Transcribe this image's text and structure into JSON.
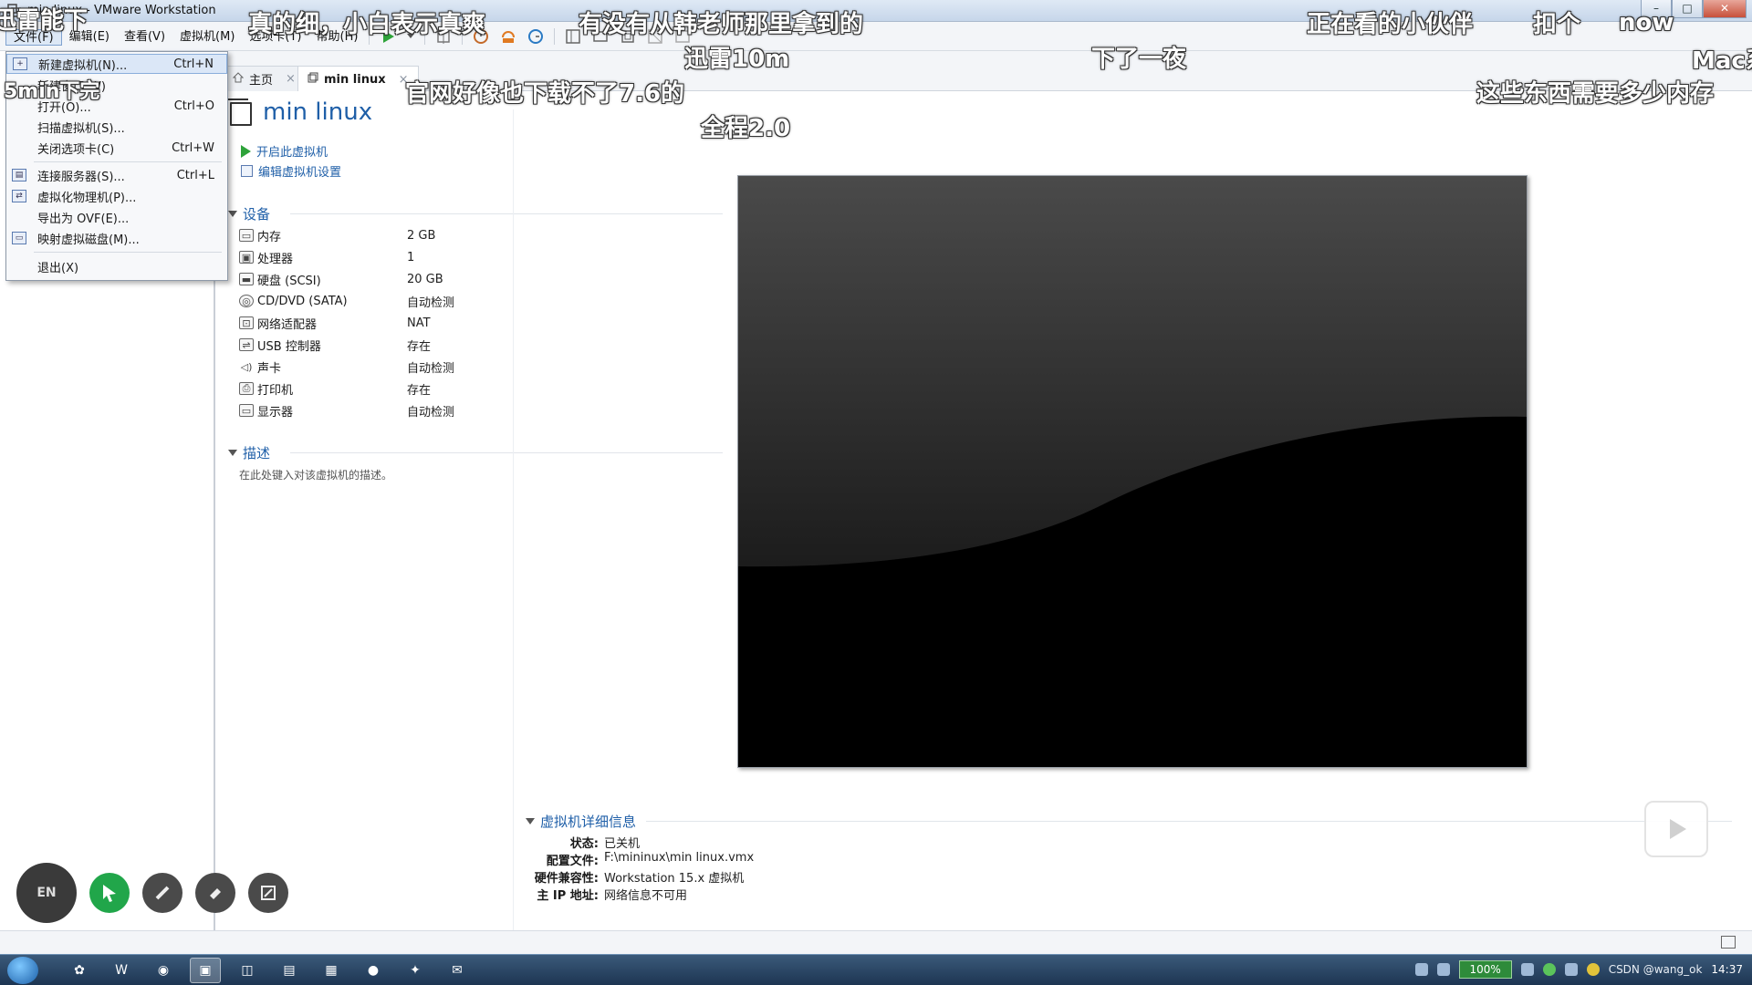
{
  "window": {
    "title": "min linux - VMware Workstation",
    "controls": {
      "minimize": "–",
      "maximize": "□",
      "close": "✕"
    }
  },
  "menu": [
    "文件(F)",
    "编辑(E)",
    "查看(V)",
    "虚拟机(M)",
    "选项卡(T)",
    "帮助(H)"
  ],
  "toolbar_icons": [
    "power-on-icon",
    "dropdown-arrow-icon",
    "send-keys-icon",
    "snapshot-icon",
    "revert-snapshot-icon",
    "snapshot-manager-icon",
    "library-view-icon",
    "thumbnail-icon",
    "full-screen-icon",
    "unity-icon",
    "console-view-icon"
  ],
  "file_menu": [
    {
      "label": "新建虚拟机(N)...",
      "shortcut": "Ctrl+N",
      "icon": "new-vm-icon"
    },
    {
      "label": "新建窗口(W)",
      "shortcut": "",
      "icon": ""
    },
    {
      "label": "打开(O)...",
      "shortcut": "Ctrl+O",
      "icon": ""
    },
    {
      "label": "扫描虚拟机(S)...",
      "shortcut": "",
      "icon": ""
    },
    {
      "label": "关闭选项卡(C)",
      "shortcut": "Ctrl+W",
      "icon": ""
    },
    {
      "label": "连接服务器(S)...",
      "shortcut": "Ctrl+L",
      "icon": "server-icon"
    },
    {
      "label": "虚拟化物理机(P)...",
      "shortcut": "",
      "icon": "virtualize-icon"
    },
    {
      "label": "导出为 OVF(E)...",
      "shortcut": "",
      "icon": ""
    },
    {
      "label": "映射虚拟磁盘(M)...",
      "shortcut": "",
      "icon": "disk-map-icon"
    },
    {
      "label": "退出(X)",
      "shortcut": "",
      "icon": ""
    }
  ],
  "tabs": [
    {
      "label": "主页",
      "close": "×"
    },
    {
      "label": "min linux",
      "close": "×"
    }
  ],
  "vm": {
    "name": "min linux",
    "actions": {
      "power_on": "开启此虚拟机",
      "edit_settings": "编辑虚拟机设置"
    },
    "devices_title": "设备",
    "devices": [
      {
        "name": "内存",
        "value": "2 GB",
        "icon": "memory-icon"
      },
      {
        "name": "处理器",
        "value": "1",
        "icon": "cpu-icon"
      },
      {
        "name": "硬盘 (SCSI)",
        "value": "20 GB",
        "icon": "hard-disk-icon"
      },
      {
        "name": "CD/DVD (SATA)",
        "value": "自动检测",
        "icon": "cd-dvd-icon"
      },
      {
        "name": "网络适配器",
        "value": "NAT",
        "icon": "network-adapter-icon"
      },
      {
        "name": "USB 控制器",
        "value": "存在",
        "icon": "usb-icon"
      },
      {
        "name": "声卡",
        "value": "自动检测",
        "icon": "sound-card-icon"
      },
      {
        "name": "打印机",
        "value": "存在",
        "icon": "printer-icon"
      },
      {
        "name": "显示器",
        "value": "自动检测",
        "icon": "display-icon"
      }
    ],
    "description_title": "描述",
    "description_placeholder": "在此处键入对该虚拟机的描述。",
    "details_title": "虚拟机详细信息",
    "details": [
      {
        "key": "状态:",
        "value": "已关机"
      },
      {
        "key": "配置文件:",
        "value": "F:\\mininux\\min linux.vmx"
      },
      {
        "key": "硬件兼容性:",
        "value": "Workstation 15.x 虚拟机"
      },
      {
        "key": "主 IP 地址:",
        "value": "网络信息不可用"
      }
    ]
  },
  "danmaku": [
    "迅雷能下",
    "5min下完",
    "真的细，小白表示真爽",
    "有没有从韩老师那里拿到的",
    "迅雷10m",
    "官网好像也下载不了7.6的",
    "全程2.0",
    "下了一夜",
    "正在看的小伙伴",
    "扣个",
    "now",
    "Mac系",
    "这些东西需要多少内存"
  ],
  "player_tools": {
    "language": "EN"
  },
  "taskbar": {
    "battery": "100%",
    "watermark": "CSDN @wang_ok",
    "clock": "14:37"
  },
  "colors": {
    "accent": "#1f5fa8",
    "play_green": "#2ea33a",
    "tool_green": "#21a64a"
  }
}
